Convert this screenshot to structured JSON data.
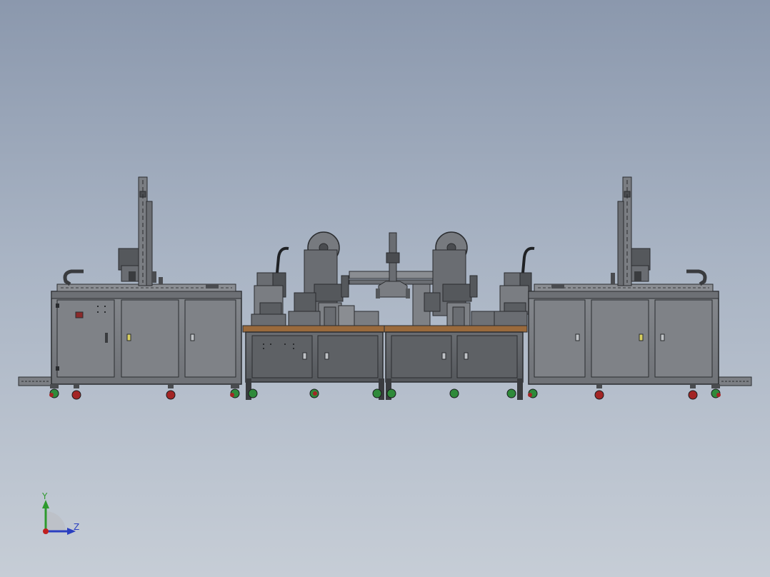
{
  "viewport": {
    "background_top": "#8b98ad",
    "background_bottom": "#c6cdd6"
  },
  "model": {
    "units": [
      "left-cabinet-unit",
      "center-workbench-left",
      "center-workbench-right",
      "right-cabinet-unit"
    ],
    "colors": {
      "frame": "#5c5f63",
      "panel": "#7e8186",
      "outline": "#2a2c2f",
      "worktop": "#9a6a3c",
      "caster_green": "#2f8a3a",
      "caster_red": "#a32525",
      "indicator_yellow": "#d8cf60"
    }
  },
  "triad": {
    "y_label": "Y",
    "z_label": "Z",
    "y_color": "#2e9a2e",
    "z_color": "#2a3fc0",
    "origin_color": "#c02020"
  }
}
